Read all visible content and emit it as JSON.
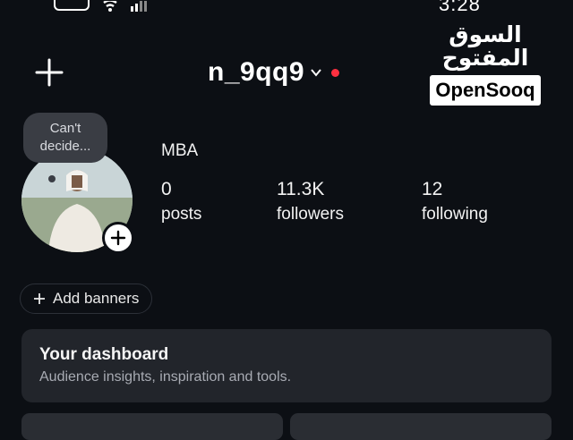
{
  "status_bar": {
    "time": "3:28",
    "icons": [
      "battery-icon",
      "wifi-icon",
      "signal-icon"
    ]
  },
  "header": {
    "username": "n_9qq9",
    "create_icon": "plus-icon",
    "switch_icon": "chevron-down-icon",
    "notification_color": "#ff3040"
  },
  "watermark": {
    "arabic": "السوق المفتوح",
    "latin": "OpenSooq"
  },
  "profile": {
    "note": "Can't decide...",
    "name": "MBA",
    "stats": {
      "posts": {
        "value": "0",
        "label": "posts"
      },
      "followers": {
        "value": "11.3K",
        "label": "followers"
      },
      "following": {
        "value": "12",
        "label": "following"
      }
    }
  },
  "banners": {
    "label": "Add banners"
  },
  "dashboard": {
    "title": "Your dashboard",
    "subtitle": "Audience insights, inspiration and tools."
  },
  "colors": {
    "background": "#0c0f14",
    "card": "#22252b",
    "accent_red": "#ff3040"
  }
}
